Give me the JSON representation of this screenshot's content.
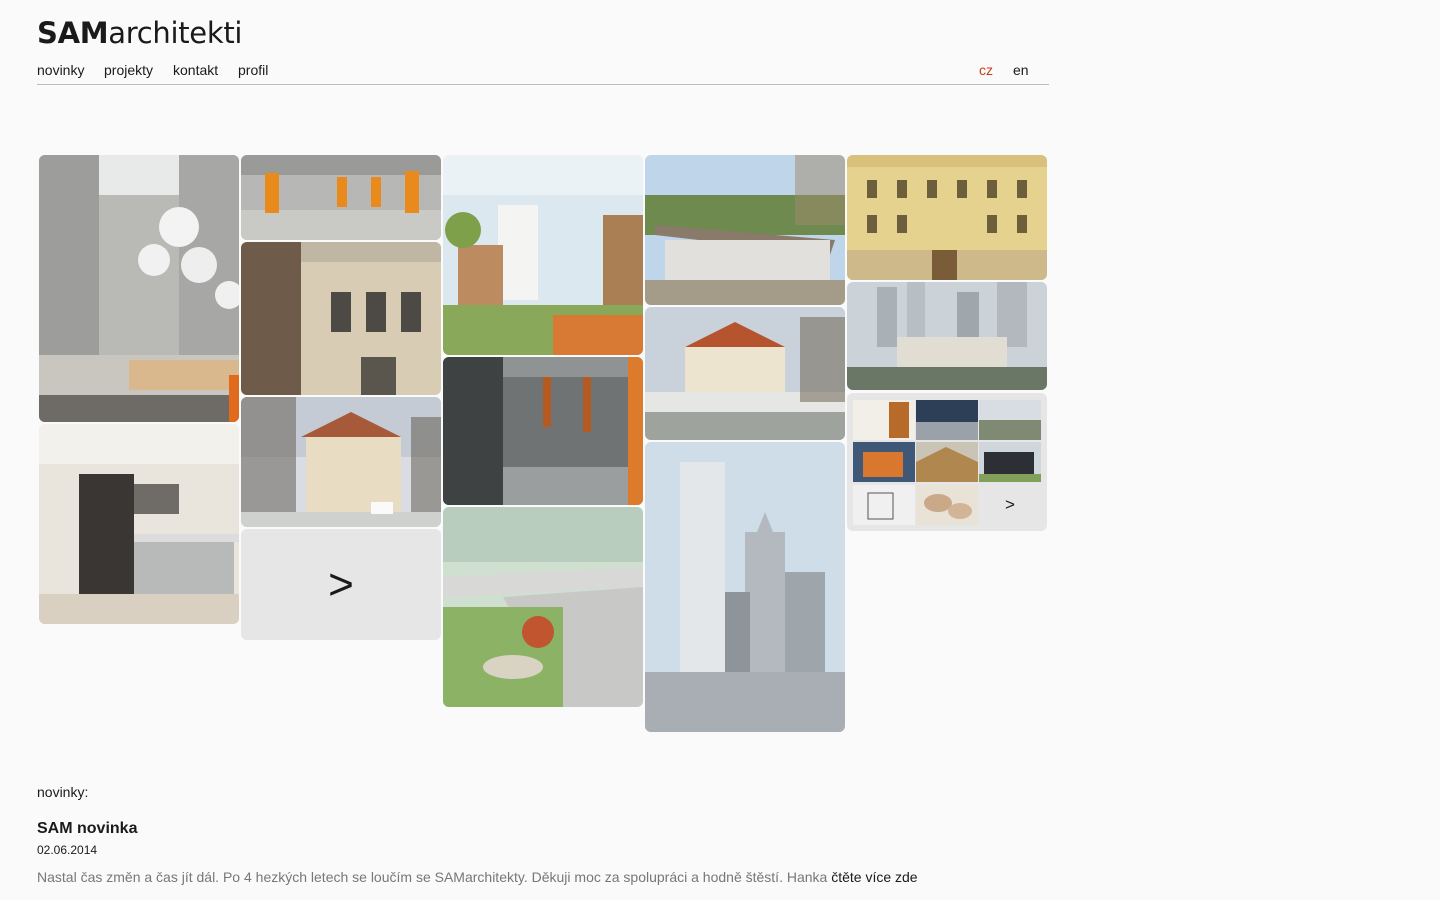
{
  "logo": {
    "bold": "SAM",
    "light": "architekti"
  },
  "nav": {
    "items": [
      "novinky",
      "projekty",
      "kontakt",
      "profil"
    ],
    "lang_cz": "cz",
    "lang_en": "en"
  },
  "gallery": {
    "more_label": ">",
    "mini_more_label": ">"
  },
  "news": {
    "heading": "novinky:",
    "title": "SAM novinka",
    "date": "02.06.2014",
    "text": "Nastal čas změn a čas jít dál. Po 4 hezkých letech se loučím se SAMarchitekty. Děkuji moc za spolupráci a hodně štěstí. Hanka",
    "link": "čtěte více zde"
  },
  "colors": {
    "accent": "#c83c12"
  }
}
